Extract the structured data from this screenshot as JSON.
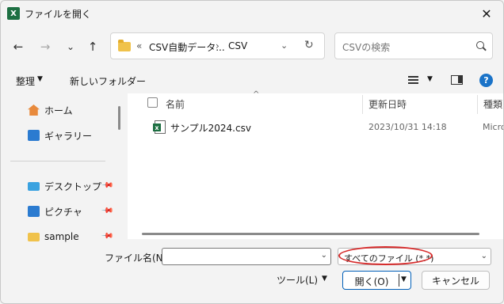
{
  "window": {
    "title": "ファイルを開く",
    "app_icon": "X",
    "close": "✕"
  },
  "nav": {
    "back": "←",
    "forward": "→",
    "recent": "⌄",
    "up": "↑"
  },
  "address": {
    "chevron": "«",
    "segments": [
      "CSV自動データ...",
      "CSV"
    ],
    "separator": "›",
    "dropdown": "⌄",
    "refresh": "↻"
  },
  "search": {
    "placeholder": "CSVの検索"
  },
  "toolbar": {
    "organize": "整理",
    "new_folder": "新しいフォルダー",
    "caret": "▼",
    "help": "?"
  },
  "sidebar": {
    "items": [
      {
        "label": "ホーム",
        "icon": "home-icon"
      },
      {
        "label": "ギャラリー",
        "icon": "gallery-icon"
      },
      {
        "label": "デスクトップ",
        "icon": "desktop-icon",
        "pinned": true
      },
      {
        "label": "ピクチャ",
        "icon": "picture-icon",
        "pinned": true
      },
      {
        "label": "sample",
        "icon": "folder-icon",
        "pinned": true
      }
    ]
  },
  "filelist": {
    "columns": {
      "name": "名前",
      "date": "更新日時",
      "type": "種類"
    },
    "sort_arrow": "^",
    "rows": [
      {
        "name": "サンプル2024.csv",
        "date": "2023/10/31 14:18",
        "type": "Micro"
      }
    ]
  },
  "bottom": {
    "filename_label": "ファイル名(N):",
    "filename_value": "",
    "filter": "すべてのファイル (*.*)",
    "tools": "ツール(L)",
    "open": "開く(O)",
    "cancel": "キャンセル",
    "dd": "⌄"
  },
  "colors": {
    "accent": "#005fb8",
    "highlight_ellipse": "#d62b2b",
    "excel_green": "#1d6f42"
  }
}
